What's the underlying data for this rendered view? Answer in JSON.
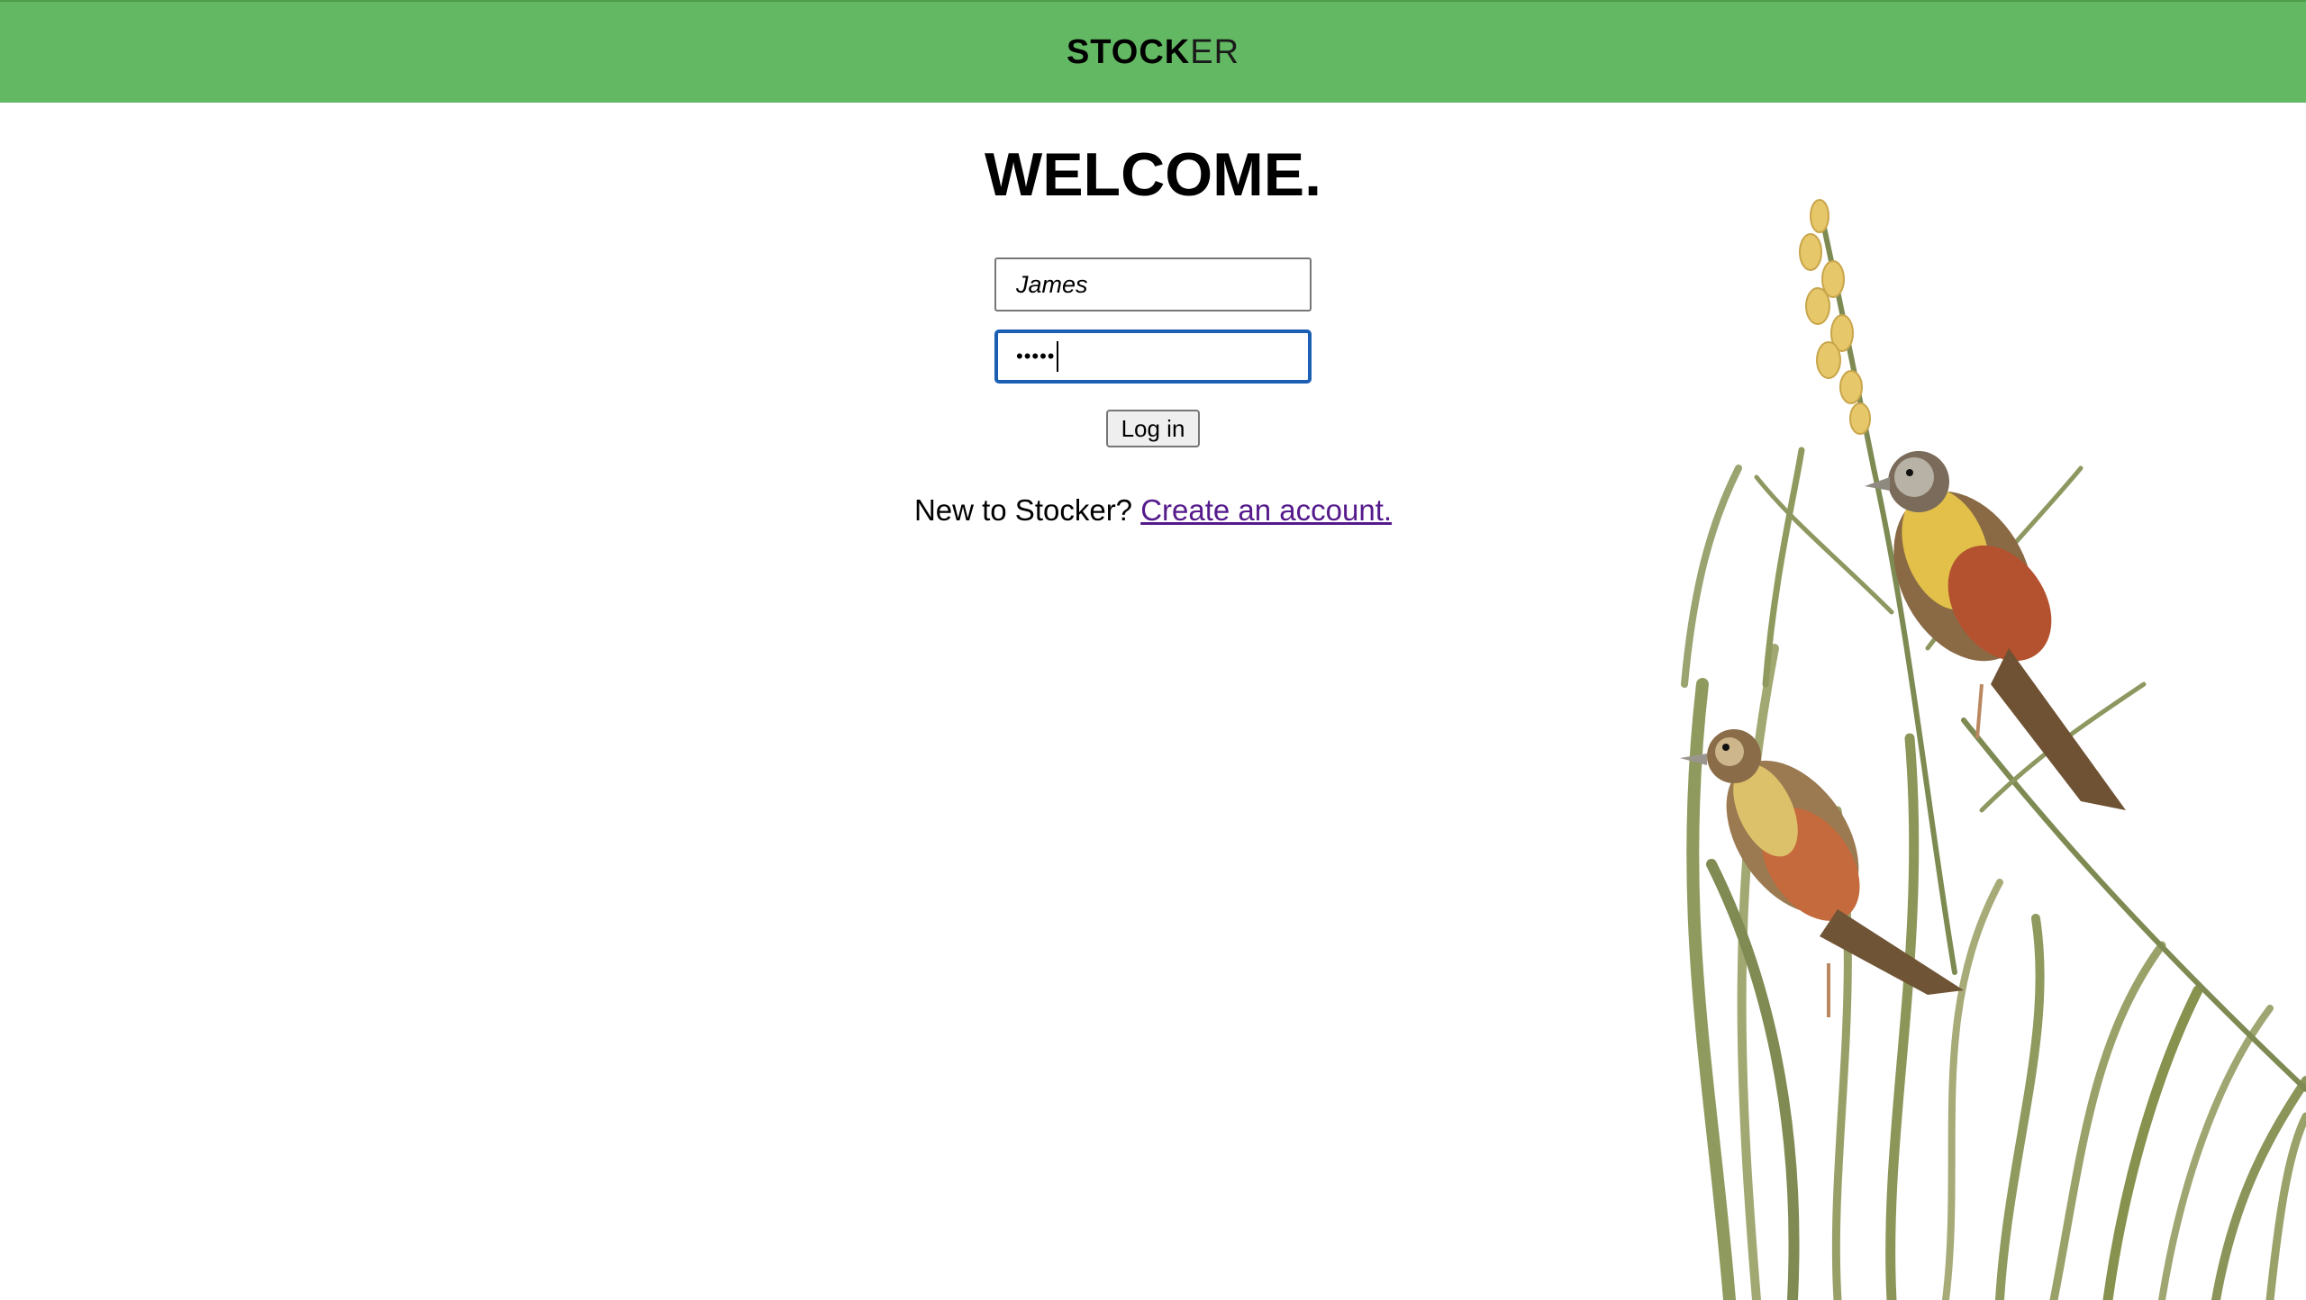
{
  "header": {
    "brand_bold": "STOCK",
    "brand_light": "ER",
    "background_color": "#63b863"
  },
  "main": {
    "title": "WELCOME.",
    "username_value": "James",
    "password_masked": "•••••",
    "login_label": "Log in",
    "signup_prompt": "New to Stocker?",
    "signup_link": "Create an account."
  },
  "illustration": {
    "icon": "birds-on-grass-illustration"
  },
  "colors": {
    "focus_border": "#1a5fb4",
    "link_visited": "#551a8b"
  }
}
